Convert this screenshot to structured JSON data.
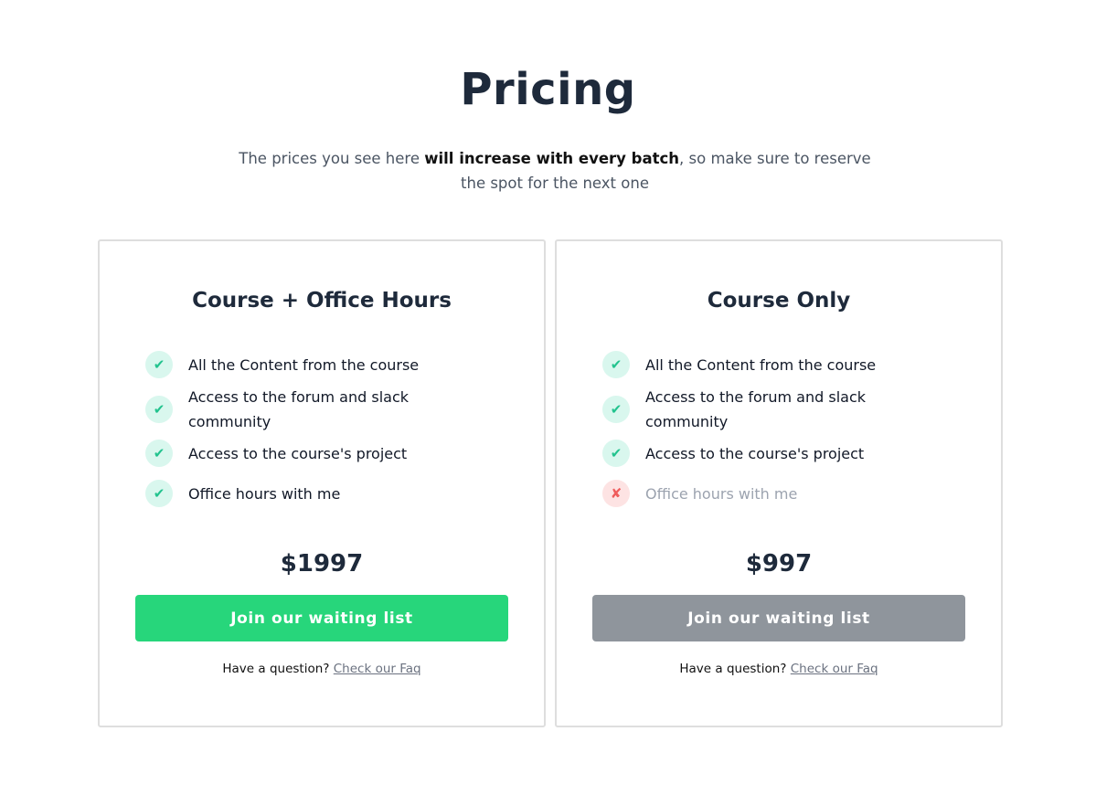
{
  "header": {
    "title": "Pricing",
    "subtitle_before": "The prices you see here ",
    "subtitle_bold": "will increase with every batch",
    "subtitle_after": ", so make sure to reserve the spot for the next one"
  },
  "plans": [
    {
      "title": "Course + Office Hours",
      "features": [
        {
          "text": "All the Content from the course",
          "included": true,
          "icon": "check-icon"
        },
        {
          "text": "Access to the forum and slack community",
          "included": true,
          "icon": "check-icon"
        },
        {
          "text": "Access to the course's project",
          "included": true,
          "icon": "check-icon"
        },
        {
          "text": "Office hours with me",
          "included": true,
          "icon": "check-icon"
        }
      ],
      "price": "$1997",
      "cta_label": "Join our waiting list",
      "cta_color": "#27d67b",
      "faq_prefix": "Have a question?",
      "faq_link": "Check our Faq"
    },
    {
      "title": "Course Only",
      "features": [
        {
          "text": "All the Content from the course",
          "included": true,
          "icon": "check-icon"
        },
        {
          "text": "Access to the forum and slack community",
          "included": true,
          "icon": "check-icon"
        },
        {
          "text": "Access to the course's project",
          "included": true,
          "icon": "check-icon"
        },
        {
          "text": "Office hours with me",
          "included": false,
          "icon": "cross-icon"
        }
      ],
      "price": "$997",
      "cta_label": "Join our waiting list",
      "cta_color": "#8f959c",
      "faq_prefix": "Have a question?",
      "faq_link": "Check our Faq"
    }
  ],
  "colors": {
    "check": "#22c38e",
    "cross": "#ef5d5d",
    "title": "#1e2a3b"
  }
}
